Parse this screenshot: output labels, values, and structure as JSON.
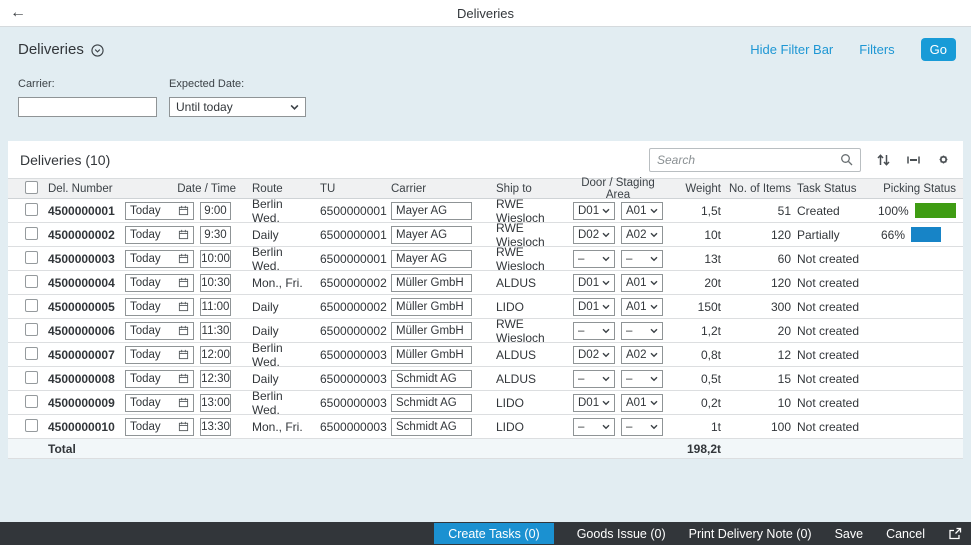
{
  "topbar": {
    "title": "Deliveries"
  },
  "filterbar": {
    "title": "Deliveries",
    "hide_filter_label": "Hide Filter Bar",
    "filters_label": "Filters",
    "go_label": "Go",
    "fields": {
      "carrier": {
        "label": "Carrier:",
        "value": ""
      },
      "expected_date": {
        "label": "Expected Date:",
        "value": "Until today"
      }
    }
  },
  "table": {
    "title": "Deliveries (10)",
    "search_placeholder": "Search",
    "toolbar_icons": [
      "sort-icon",
      "column-width-icon",
      "settings-gear-icon"
    ],
    "columns": [
      "Del. Number",
      "Date / Time",
      "Route",
      "TU",
      "Carrier",
      "Ship to",
      "Door / Staging Area",
      "Weight",
      "No. of Items",
      "Task Status",
      "Picking Status"
    ],
    "rows": [
      {
        "del_number": "4500000001",
        "date": "Today",
        "time": "9:00",
        "route": "Berlin Wed.",
        "tu": "6500000001",
        "carrier": "Mayer AG",
        "ship_to": "RWE Wiesloch",
        "door": "D01",
        "staging": "A01",
        "weight": "1,5t",
        "items": "51",
        "task_status": "Created",
        "picking": {
          "percent": "100%",
          "value": 100,
          "color": "#3f9c13"
        }
      },
      {
        "del_number": "4500000002",
        "date": "Today",
        "time": "9:30",
        "route": "Daily",
        "tu": "6500000001",
        "carrier": "Mayer AG",
        "ship_to": "RWE Wiesloch",
        "door": "D02",
        "staging": "A02",
        "weight": "10t",
        "items": "120",
        "task_status": "Partially",
        "picking": {
          "percent": "66%",
          "value": 66,
          "color": "#1784c7"
        }
      },
      {
        "del_number": "4500000003",
        "date": "Today",
        "time": "10:00",
        "route": "Berlin Wed.",
        "tu": "6500000001",
        "carrier": "Mayer AG",
        "ship_to": "RWE Wiesloch",
        "door": "–",
        "staging": "–",
        "weight": "13t",
        "items": "60",
        "task_status": "Not created",
        "picking": null
      },
      {
        "del_number": "4500000004",
        "date": "Today",
        "time": "10:30",
        "route": "Mon., Fri.",
        "tu": "6500000002",
        "carrier": "Müller GmbH",
        "ship_to": "ALDUS",
        "door": "D01",
        "staging": "A01",
        "weight": "20t",
        "items": "120",
        "task_status": "Not created",
        "picking": null
      },
      {
        "del_number": "4500000005",
        "date": "Today",
        "time": "11:00",
        "route": "Daily",
        "tu": "6500000002",
        "carrier": "Müller GmbH",
        "ship_to": "LIDO",
        "door": "D01",
        "staging": "A01",
        "weight": "150t",
        "items": "300",
        "task_status": "Not created",
        "picking": null
      },
      {
        "del_number": "4500000006",
        "date": "Today",
        "time": "11:30",
        "route": "Daily",
        "tu": "6500000002",
        "carrier": "Müller GmbH",
        "ship_to": "RWE Wiesloch",
        "door": "–",
        "staging": "–",
        "weight": "1,2t",
        "items": "20",
        "task_status": "Not created",
        "picking": null
      },
      {
        "del_number": "4500000007",
        "date": "Today",
        "time": "12:00",
        "route": "Berlin Wed.",
        "tu": "6500000003",
        "carrier": "Müller GmbH",
        "ship_to": "ALDUS",
        "door": "D02",
        "staging": "A02",
        "weight": "0,8t",
        "items": "12",
        "task_status": "Not created",
        "picking": null
      },
      {
        "del_number": "4500000008",
        "date": "Today",
        "time": "12:30",
        "route": "Daily",
        "tu": "6500000003",
        "carrier": "Schmidt AG",
        "ship_to": "ALDUS",
        "door": "–",
        "staging": "–",
        "weight": "0,5t",
        "items": "15",
        "task_status": "Not created",
        "picking": null
      },
      {
        "del_number": "4500000009",
        "date": "Today",
        "time": "13:00",
        "route": "Berlin Wed.",
        "tu": "6500000003",
        "carrier": "Schmidt AG",
        "ship_to": "LIDO",
        "door": "D01",
        "staging": "A01",
        "weight": "0,2t",
        "items": "10",
        "task_status": "Not created",
        "picking": null
      },
      {
        "del_number": "4500000010",
        "date": "Today",
        "time": "13:30",
        "route": "Mon., Fri.",
        "tu": "6500000003",
        "carrier": "Schmidt AG",
        "ship_to": "LIDO",
        "door": "–",
        "staging": "–",
        "weight": "1t",
        "items": "100",
        "task_status": "Not created",
        "picking": null
      }
    ],
    "total": {
      "label": "Total",
      "weight": "198,2t"
    }
  },
  "footer": {
    "actions": [
      {
        "label": "Create Tasks (0)",
        "primary": true
      },
      {
        "label": "Goods Issue (0)",
        "primary": false
      },
      {
        "label": "Print Delivery Note (0)",
        "primary": false
      },
      {
        "label": "Save",
        "primary": false
      },
      {
        "label": "Cancel",
        "primary": false
      }
    ],
    "share_icon": "share-icon"
  },
  "colors": {
    "page_background": "#e2edf2",
    "accent_blue": "#189bd7",
    "create_tasks_blue": "#1b91d1",
    "link_blue": "#1e97d4",
    "picking_green": "#3f9c13",
    "picking_blue": "#1784c7",
    "footer_background": "#32363a"
  }
}
